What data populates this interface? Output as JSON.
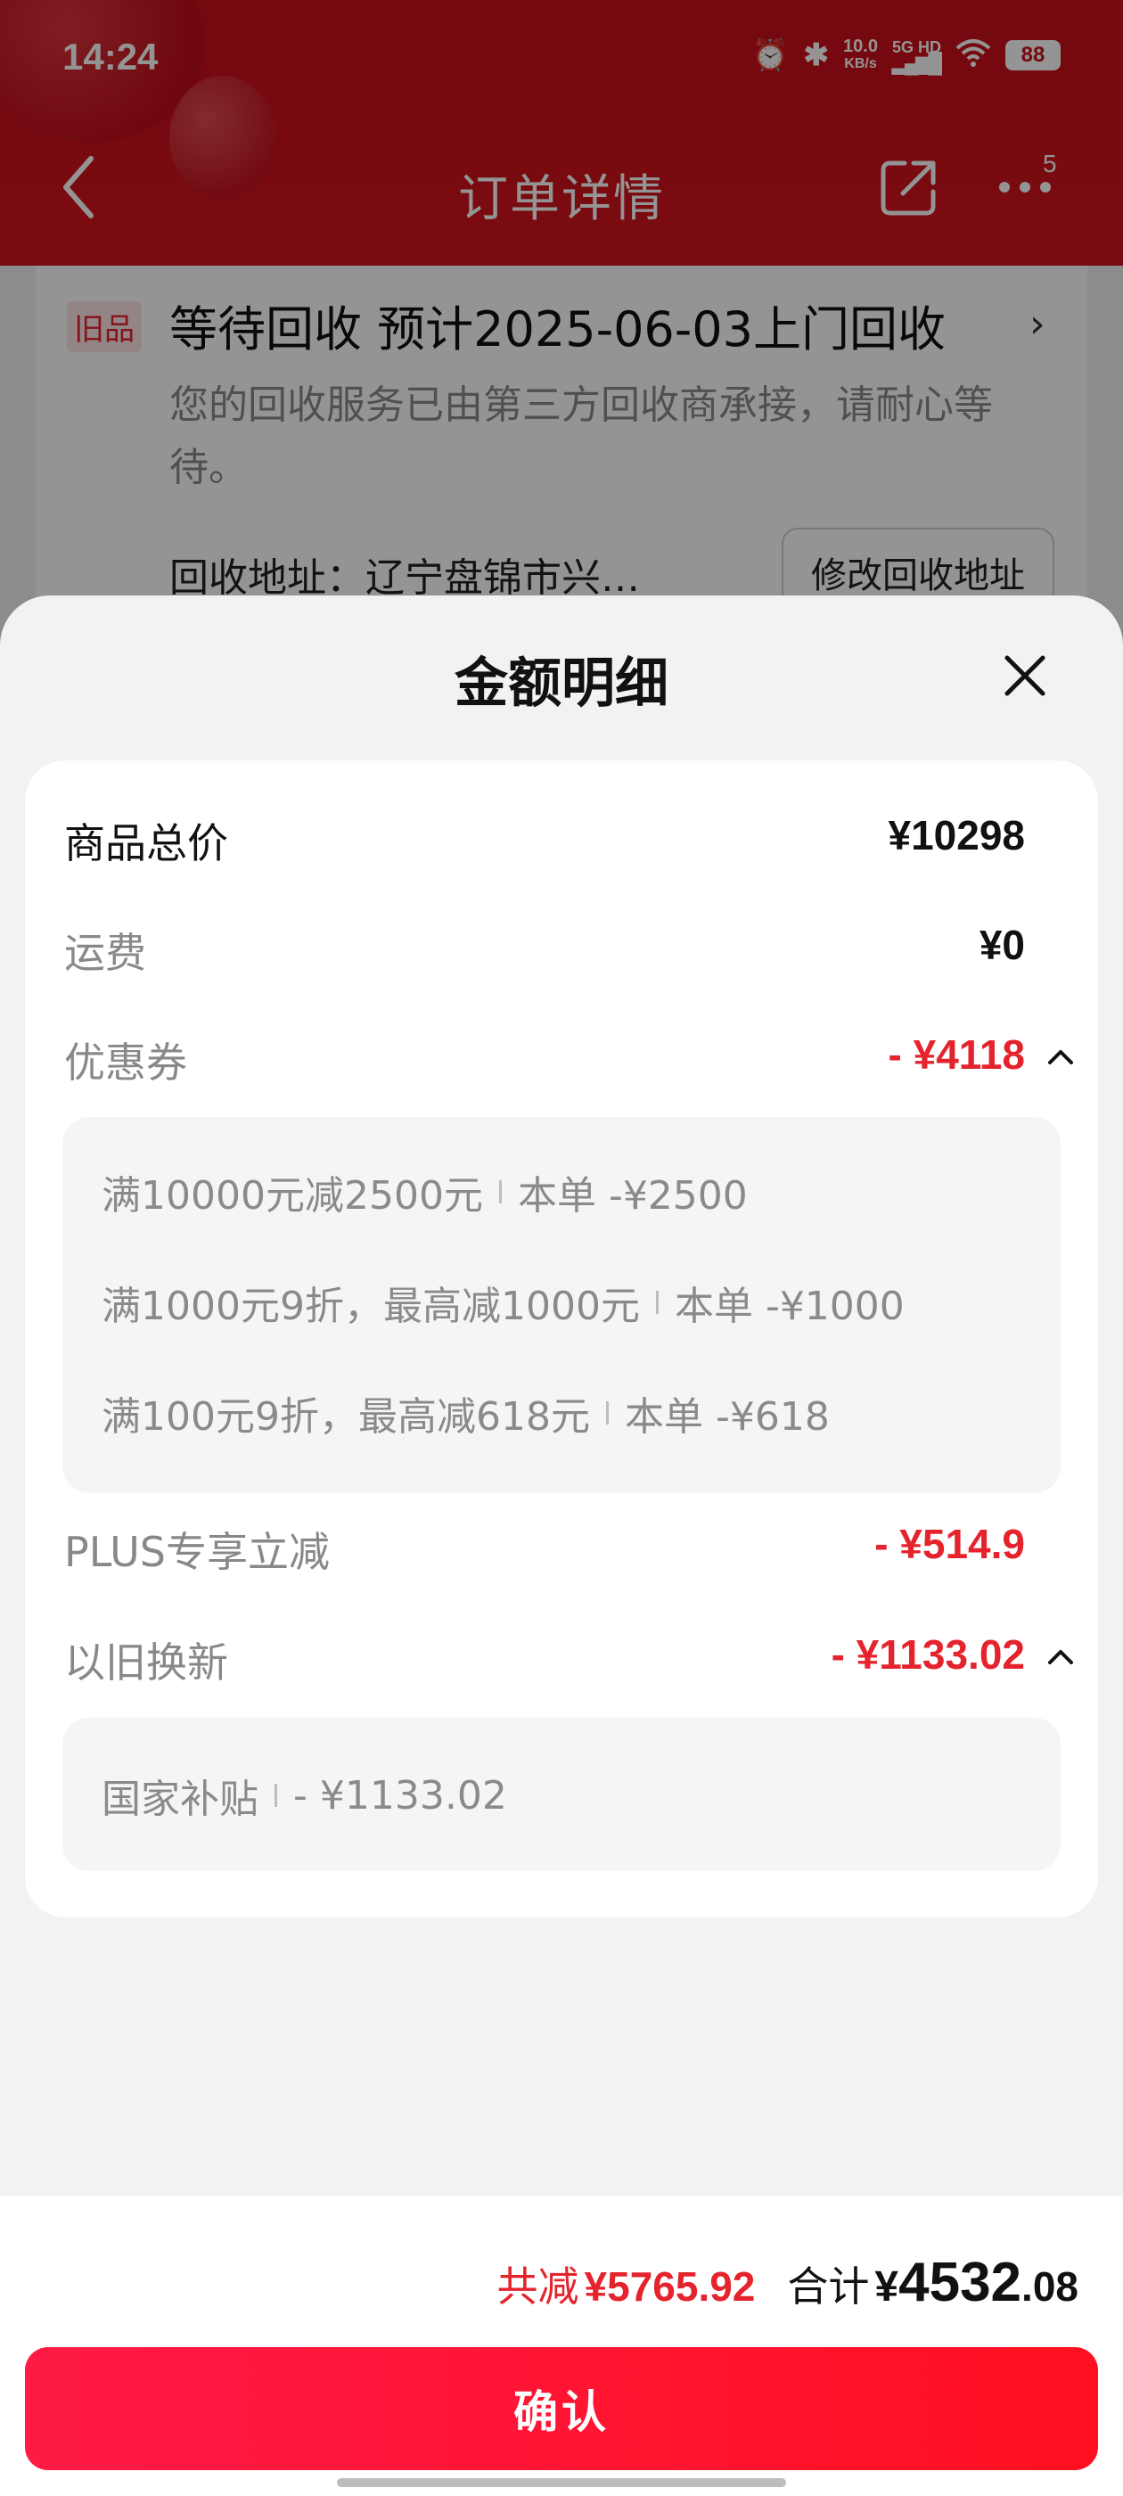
{
  "status_bar": {
    "time": "14:24",
    "net_speed_top": "10.0",
    "net_speed_unit": "KB/s",
    "network": "5G HD",
    "battery": "88"
  },
  "nav": {
    "title": "订单详情",
    "badge": "5"
  },
  "background_card": {
    "tag": "旧品",
    "status_title": "等待回收 预计2025-06-03上门回收",
    "description": "您的回收服务已由第三方回收商承接，请耐心等待。",
    "address": "回收地址：辽宁盘锦市兴…",
    "modify_button": "修改回收地址"
  },
  "sheet": {
    "title": "金额明细",
    "rows": [
      {
        "label": "商品总价",
        "value": "¥10298"
      },
      {
        "label": "运费",
        "value": "¥0"
      },
      {
        "label": "优惠券",
        "value": "- ¥4118"
      },
      {
        "label": "PLUS专享立减",
        "value": "- ¥514.9"
      },
      {
        "label": "以旧换新",
        "value": "- ¥1133.02"
      }
    ],
    "coupon_details": [
      {
        "rule": "满10000元减2500元",
        "this_order": "本单 -¥2500"
      },
      {
        "rule": "满1000元9折，最高减1000元",
        "this_order": "本单 -¥1000"
      },
      {
        "rule": "满100元9折，最高减618元",
        "this_order": "本单 -¥618"
      }
    ],
    "tradein_details": [
      {
        "rule": "国家补贴",
        "this_order": "- ¥1133.02"
      }
    ]
  },
  "footer": {
    "reduce_label": "共减",
    "reduce_value": "¥5765.92",
    "total_label": "合计",
    "total_symbol": "¥",
    "total_integer": "4532",
    "total_decimal": ".08",
    "confirm": "确认"
  },
  "colors": {
    "brand_red": "#e5232d",
    "header_red": "#c8101a",
    "button_gradient_start": "#ff1a47",
    "button_gradient_end": "#ff0f1f"
  }
}
